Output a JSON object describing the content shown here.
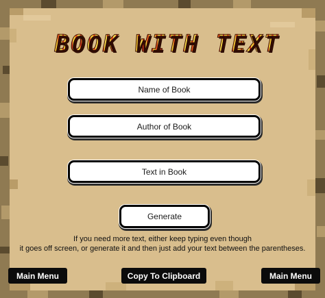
{
  "title": "BOOK WITH TEXT",
  "fields": {
    "name_label": "Name of Book",
    "author_label": "Author of Book",
    "text_label": "Text in Book"
  },
  "generate_label": "Generate",
  "info": {
    "line1": "If you need more text, either keep typing even though",
    "line2": "it goes off screen, or generate it and then just add your text between the parentheses."
  },
  "footer": {
    "main_menu_left": "Main Menu",
    "copy_label": "Copy To Clipboard",
    "main_menu_right": "Main Menu"
  },
  "colors": {
    "parchment": "#d9be8d",
    "border": "#8f7a52",
    "button_dark": "#0b0b0b",
    "title_fire": "#f3b22a"
  }
}
